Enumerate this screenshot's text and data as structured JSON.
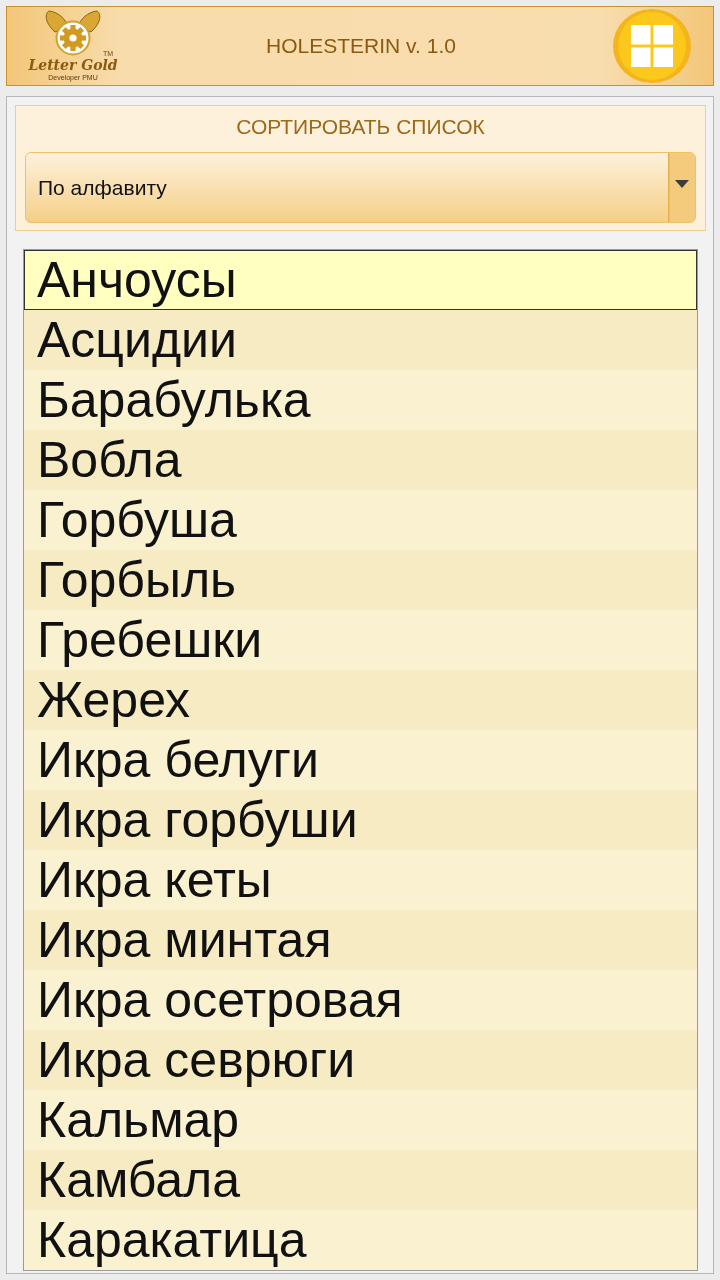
{
  "header": {
    "logo": {
      "name": "Letter Gold",
      "trademark": "TM",
      "tagline": "Developer PMU"
    },
    "title": "HOLESTERIN v. 1.0"
  },
  "sort": {
    "label": "СОРТИРОВАТЬ СПИСОК",
    "dropdown": {
      "value": "По алфавиту"
    }
  },
  "list": {
    "items": [
      {
        "label": "Анчоусы",
        "selected": true
      },
      {
        "label": "Асцидии",
        "selected": false
      },
      {
        "label": "Барабулька",
        "selected": false
      },
      {
        "label": "Вобла",
        "selected": false
      },
      {
        "label": "Горбуша",
        "selected": false
      },
      {
        "label": "Горбыль",
        "selected": false
      },
      {
        "label": "Гребешки",
        "selected": false
      },
      {
        "label": "Жерех",
        "selected": false
      },
      {
        "label": "Икра белуги",
        "selected": false
      },
      {
        "label": "Икра горбуши",
        "selected": false
      },
      {
        "label": "Икра кеты",
        "selected": false
      },
      {
        "label": "Икра минтая",
        "selected": false
      },
      {
        "label": "Икра осетровая",
        "selected": false
      },
      {
        "label": "Икра севрюги",
        "selected": false
      },
      {
        "label": "Кальмар",
        "selected": false
      },
      {
        "label": "Камбала",
        "selected": false
      },
      {
        "label": "Каракатица",
        "selected": false
      }
    ]
  }
}
